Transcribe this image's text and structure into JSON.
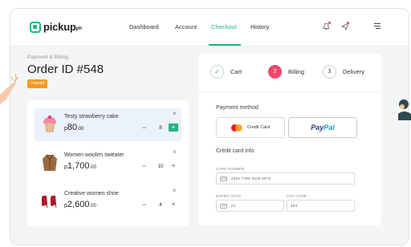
{
  "brand": {
    "name": "pickup",
    "suffix": "ph"
  },
  "nav": {
    "links": [
      {
        "label": "Dashboard"
      },
      {
        "label": "Account"
      },
      {
        "label": "Checkout"
      },
      {
        "label": "History"
      }
    ],
    "active": "Checkout",
    "icons": [
      "bell-icon",
      "send-icon",
      "menu-icon"
    ]
  },
  "order": {
    "eyebrow": "Payment & Billing",
    "title": "Order ID #548",
    "status": "Unpaid"
  },
  "cart": {
    "items": [
      {
        "name": "Testy strawberry cake",
        "currency": "p",
        "price": "80",
        "cents": ".00",
        "qty": "8",
        "icon": "cupcake-icon"
      },
      {
        "name": "Women woolen sweater",
        "currency": "p",
        "price": "1,700",
        "cents": ".00",
        "qty": "10",
        "icon": "sweater-icon"
      },
      {
        "name": "Creative women shoe",
        "currency": "p",
        "price": "2,600",
        "cents": ".00",
        "qty": "4",
        "icon": "shoe-icon"
      }
    ],
    "close_symbol": "×",
    "minus_symbol": "−",
    "plus_symbol": "+"
  },
  "steps": [
    {
      "label": "Cart",
      "marker": "✓",
      "state": "done"
    },
    {
      "label": "Billing",
      "marker": "2",
      "state": "active"
    },
    {
      "label": "Delivery",
      "marker": "3",
      "state": "pending"
    }
  ],
  "payment": {
    "heading": "Payment method",
    "credit_label": "Credit Card",
    "paypal_pay": "Pay",
    "paypal_pal": "Pal"
  },
  "card_info": {
    "heading": "Credit card info",
    "number_label": "CARD NUMBER",
    "number_value": "2384  7489  6549  9870",
    "expiry_label": "EXPIRY DATE",
    "expiry_value": "22",
    "cvv_label": "CVV CODE",
    "cvv_value": "483"
  },
  "colors": {
    "accent": "#1fb57f",
    "badge": "#f59a1c",
    "active_step": "#f0476a",
    "paypal_dark": "#253b80",
    "paypal_light": "#179bd7"
  }
}
